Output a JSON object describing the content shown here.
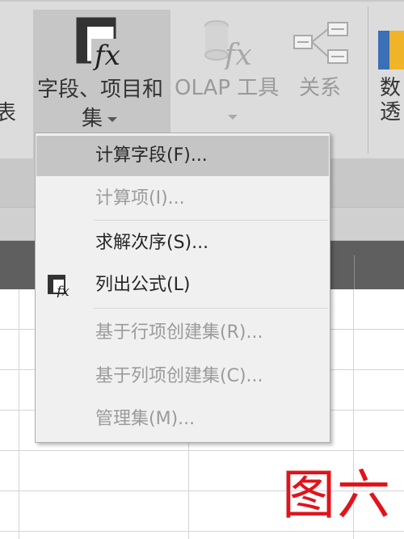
{
  "ribbon": {
    "left_partial_text": "表",
    "fields_button": {
      "line1": "字段、项目和",
      "line2": "集"
    },
    "olap_button": {
      "label": "OLAP 工具"
    },
    "relations_button": {
      "label": "关系"
    },
    "right_partial": {
      "line1": "数",
      "line2": "透"
    }
  },
  "menu": {
    "items": [
      {
        "label": "计算字段(F)...",
        "state": "highlighted"
      },
      {
        "label": "计算项(I)...",
        "state": "disabled"
      },
      {
        "label": "求解次序(S)...",
        "state": "enabled"
      },
      {
        "label": "列出公式(L)",
        "state": "enabled",
        "icon": "list-formulas-icon"
      },
      {
        "label": "基于行项创建集(R)...",
        "state": "disabled"
      },
      {
        "label": "基于列项创建集(C)...",
        "state": "disabled"
      },
      {
        "label": "管理集(M)...",
        "state": "disabled"
      }
    ]
  },
  "caption": "图六",
  "colors": {
    "caption": "#e0141b",
    "highlight": "#c5c5c5",
    "ribbon": "#dcdcdc",
    "header": "#5f5f5f"
  }
}
